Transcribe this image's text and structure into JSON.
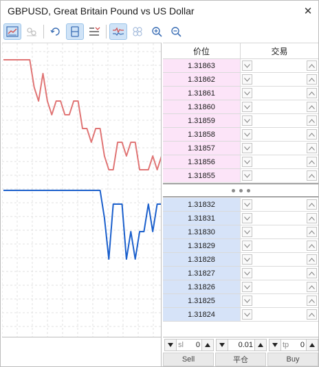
{
  "window": {
    "title": "GBPUSD, Great Britain Pound vs US Dollar",
    "close_glyph": "✕"
  },
  "toolbar": {
    "buttons": [
      {
        "icon": "chart-icon",
        "state": "active"
      },
      {
        "icon": "scale-icon",
        "state": "disabled"
      },
      {
        "icon": "refresh-icon",
        "state": "normal"
      },
      {
        "icon": "center-bar-icon",
        "state": "active"
      },
      {
        "icon": "list-settings-icon",
        "state": "normal"
      },
      {
        "icon": "tick-chart-icon",
        "state": "active"
      },
      {
        "icon": "volumes-icon",
        "state": "disabled"
      },
      {
        "icon": "zoom-in-icon",
        "state": "normal"
      },
      {
        "icon": "zoom-out-icon",
        "state": "normal"
      }
    ]
  },
  "dom": {
    "header": {
      "price": "价位",
      "trade": "交易"
    },
    "asks": [
      "1.31863",
      "1.31862",
      "1.31861",
      "1.31860",
      "1.31859",
      "1.31858",
      "1.31857",
      "1.31856",
      "1.31855"
    ],
    "bids": [
      "1.31832",
      "1.31831",
      "1.31830",
      "1.31829",
      "1.31828",
      "1.31827",
      "1.31826",
      "1.31825",
      "1.31824"
    ],
    "colors": {
      "ask_bg": "#fce4f8",
      "bid_bg": "#d6e3f8"
    }
  },
  "chart_data": {
    "type": "line",
    "series": [
      {
        "color": "#e07474",
        "values": [
          1.31863,
          1.31863,
          1.31863,
          1.31863,
          1.31863,
          1.31863,
          1.31863,
          1.31861,
          1.3186,
          1.31862,
          1.3186,
          1.31859,
          1.3186,
          1.3186,
          1.31859,
          1.31859,
          1.3186,
          1.3186,
          1.31858,
          1.31858,
          1.31857,
          1.31858,
          1.31858,
          1.31856,
          1.31855,
          1.31855,
          1.31857,
          1.31857,
          1.31856,
          1.31857,
          1.31857,
          1.31855,
          1.31855,
          1.31855,
          1.31856,
          1.31855,
          1.31856
        ]
      },
      {
        "color": "#1a5fcc",
        "values": [
          1.31833,
          1.31833,
          1.31833,
          1.31833,
          1.31833,
          1.31833,
          1.31833,
          1.31833,
          1.31833,
          1.31833,
          1.31833,
          1.31833,
          1.31833,
          1.31833,
          1.31833,
          1.31833,
          1.31833,
          1.31833,
          1.31833,
          1.31833,
          1.31833,
          1.31833,
          1.31833,
          1.31831,
          1.31828,
          1.31832,
          1.31832,
          1.31832,
          1.31828,
          1.3183,
          1.31828,
          1.3183,
          1.3183,
          1.31832,
          1.3183,
          1.31832,
          1.31832
        ]
      }
    ],
    "grid": true
  },
  "controls": {
    "sl_label": "sl",
    "sl_value": "0",
    "volume_value": "0.01",
    "tp_label": "tp",
    "tp_value": "0",
    "sell_label": "Sell",
    "close_label": "平仓",
    "buy_label": "Buy"
  }
}
